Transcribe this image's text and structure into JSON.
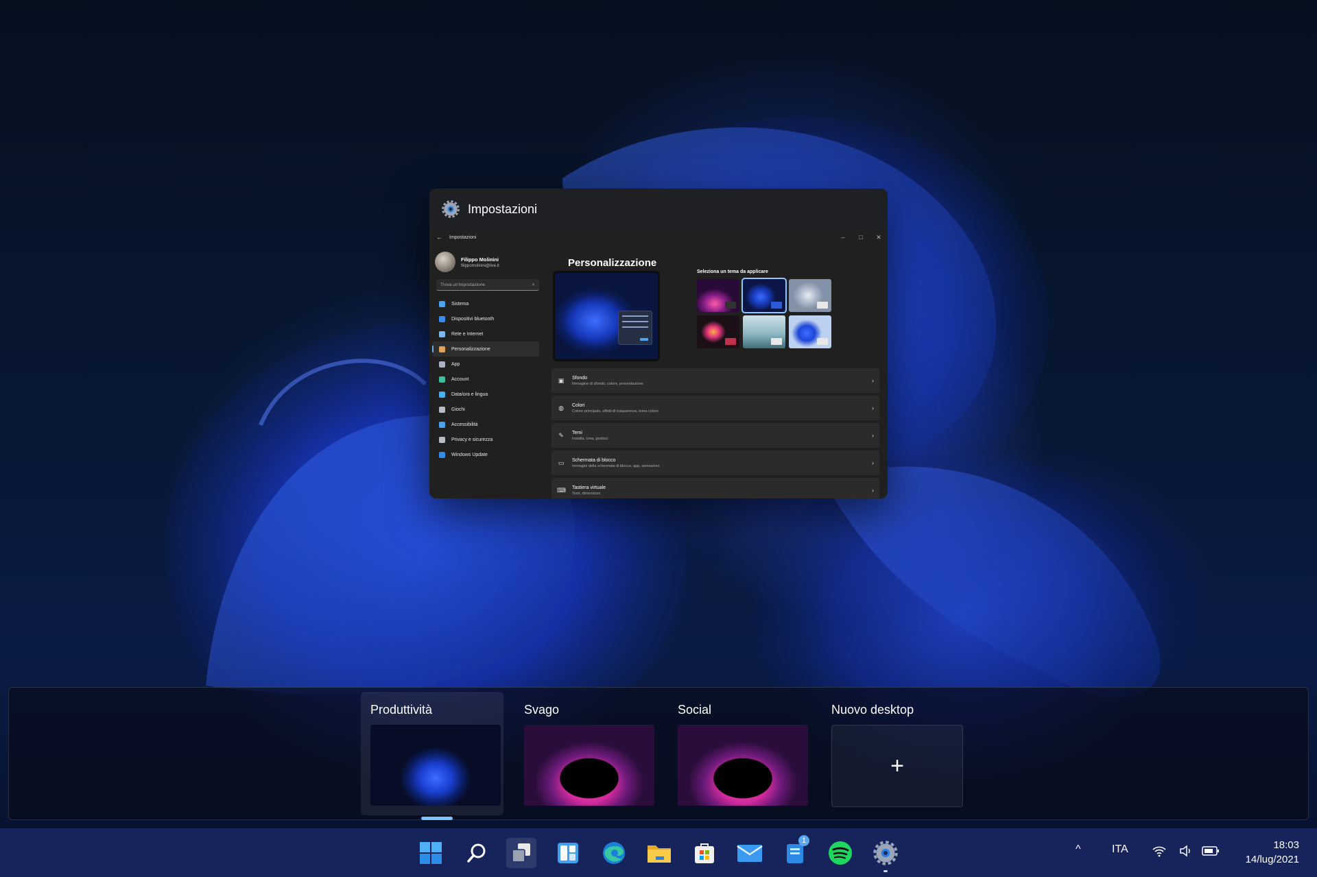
{
  "preview": {
    "title": "Impostazioni",
    "app": {
      "titlebar": "Impostazioni",
      "window_controls": [
        "–",
        "□",
        "✕"
      ],
      "profile": {
        "name": "Filippo Molinini",
        "email": "filippomolinini@live.it"
      },
      "search_placeholder": "Trova un'impostazione",
      "nav": [
        {
          "label": "Sistema",
          "icon": "monitor-icon",
          "color": "#4aa3f0"
        },
        {
          "label": "Dispositivi bluetooth",
          "icon": "bluetooth-icon",
          "color": "#3b8ef0"
        },
        {
          "label": "Rete e Internet",
          "icon": "network-icon",
          "color": "#7bb9f2"
        },
        {
          "label": "Personalizzazione",
          "icon": "brush-icon",
          "color": "#e3a15a"
        },
        {
          "label": "App",
          "icon": "apps-icon",
          "color": "#a9b3c4"
        },
        {
          "label": "Account",
          "icon": "person-icon",
          "color": "#3cc0a0"
        },
        {
          "label": "Data/ora e lingua",
          "icon": "globe-clock-icon",
          "color": "#4ab0ef"
        },
        {
          "label": "Giochi",
          "icon": "gamepad-icon",
          "color": "#b7bcc6"
        },
        {
          "label": "Accessibilità",
          "icon": "accessibility-icon",
          "color": "#4aa3f0"
        },
        {
          "label": "Privacy e sicurezza",
          "icon": "shield-icon",
          "color": "#b7bcc6"
        },
        {
          "label": "Windows Update",
          "icon": "update-icon",
          "color": "#2f8ee6"
        }
      ],
      "active_nav": "Personalizzazione",
      "page_title": "Personalizzazione",
      "themes_label": "Seleziona un tema da applicare",
      "rows": [
        {
          "title": "Sfondo",
          "subtitle": "Immagine di sfondo, colore, presentazione",
          "icon": "image-icon"
        },
        {
          "title": "Colori",
          "subtitle": "Colore principale, effetti di trasparenza, tema colore",
          "icon": "palette-icon"
        },
        {
          "title": "Temi",
          "subtitle": "Installa, crea, gestisci",
          "icon": "pen-icon"
        },
        {
          "title": "Schermata di blocco",
          "subtitle": "Immagini della schermata di blocco, app, animazioni",
          "icon": "lock-screen-icon"
        },
        {
          "title": "Tastiera virtuale",
          "subtitle": "Temi, dimensioni",
          "icon": "keyboard-icon"
        }
      ]
    }
  },
  "desktops": [
    {
      "label": "Produttività",
      "current": true
    },
    {
      "label": "Svago",
      "current": false
    },
    {
      "label": "Social",
      "current": false
    },
    {
      "label": "Nuovo desktop",
      "add": "+"
    }
  ],
  "taskbar": {
    "apps": [
      "start-icon",
      "search-icon",
      "task-view-icon",
      "widgets-icon",
      "edge-icon",
      "file-explorer-icon",
      "store-icon",
      "mail-icon",
      "todo-icon",
      "spotify-icon",
      "settings-icon"
    ],
    "todo_badge": "1",
    "language": "ITA",
    "tray_overflow": "^",
    "time": "18:03",
    "date": "14/lug/2021"
  },
  "colors": {
    "accent": "#5fb2f2",
    "taskbar": "#182660",
    "spotify": "#1ed760"
  }
}
